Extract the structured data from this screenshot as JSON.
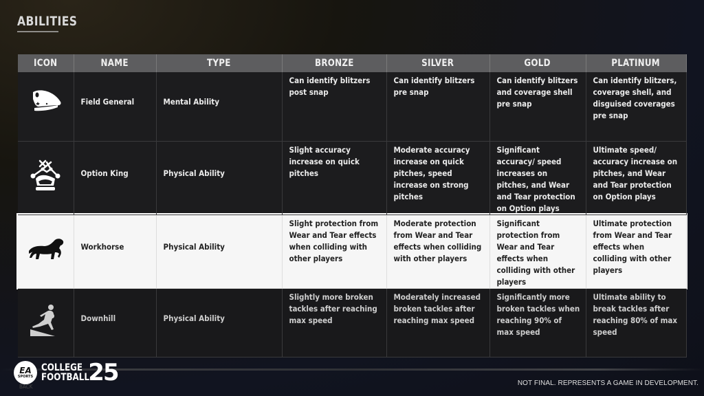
{
  "page": {
    "title": "ABILITIES",
    "disclaimer": "NOT FINAL. REPRESENTS A GAME IN DEVELOPMENT.",
    "back_hint": "BACK"
  },
  "logo": {
    "badge_top": "EA",
    "badge_bottom": "SPORTS",
    "line1": "COLLEGE",
    "line2": "FOOTBALL",
    "number": "25"
  },
  "table": {
    "headers": [
      "ICON",
      "NAME",
      "TYPE",
      "BRONZE",
      "SILVER",
      "GOLD",
      "PLATINUM"
    ],
    "rows": [
      {
        "icon": "officer-cap-icon",
        "name": "Field General",
        "type": "Mental Ability",
        "bronze": "Can identify blitzers post snap",
        "silver": "Can identify blitzers pre snap",
        "gold": "Can identify blitzers and coverage shell pre snap",
        "platinum": "Can identify blitzers, coverage shell, and disguised coverages pre snap",
        "selected": false
      },
      {
        "icon": "crown-option-icon",
        "name": "Option King",
        "type": "Physical Ability",
        "bronze": "Slight accuracy increase on quick pitches",
        "silver": "Moderate accuracy increase on quick pitches, speed increase on strong pitches",
        "gold": "Significant accuracy/ speed increases on pitches, and Wear and Tear protection on Option plays",
        "platinum": "Ultimate speed/ accuracy increase on pitches, and Wear and Tear protection on Option plays",
        "selected": false
      },
      {
        "icon": "horse-icon",
        "name": "Workhorse",
        "type": "Physical Ability",
        "bronze": "Slight protection from Wear and Tear effects when colliding with other players",
        "silver": "Moderate protection from Wear and Tear effects when colliding with other players",
        "gold": "Significant protection from Wear and Tear effects when colliding with other players",
        "platinum": "Ultimate protection from Wear and Tear effects when colliding with other players",
        "selected": true
      },
      {
        "icon": "downhill-runner-icon",
        "name": "Downhill",
        "type": "Physical Ability",
        "bronze": "Slightly more broken tackles after reaching max speed",
        "silver": "Moderately increased broken tackles after reaching max speed",
        "gold": "Significantly more broken tackles when reaching 90% of max speed",
        "platinum": "Ultimate ability to break tackles after reaching 80% of max speed",
        "selected": false
      }
    ]
  },
  "colors": {
    "header_bg": "#5d5d5f",
    "row_bg": "#1c1c1e",
    "selected_row_bg": "#f6f6f6"
  }
}
